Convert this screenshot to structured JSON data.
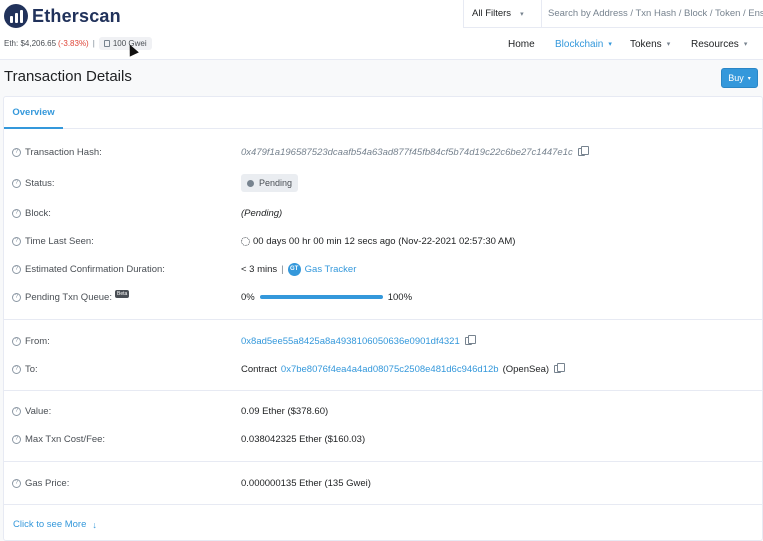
{
  "brand": {
    "name": "Etherscan"
  },
  "search": {
    "filter_label": "All Filters",
    "placeholder": "Search by Address / Txn Hash / Block / Token / Ens"
  },
  "ticker": {
    "eth_price": "Eth: $4,206.65",
    "change": "(-3.83%)",
    "separator": "|",
    "gas": "100 Gwei"
  },
  "nav": {
    "home": "Home",
    "blockchain": "Blockchain",
    "tokens": "Tokens",
    "resources": "Resources"
  },
  "page": {
    "title": "Transaction Details",
    "buy_label": "Buy"
  },
  "tabs": {
    "overview": "Overview"
  },
  "details": {
    "hash": {
      "label": "Transaction Hash:",
      "value": "0x479f1a196587523dcaafb54a63ad877f45fb84cf5b74d19c22c6be27c1447e1c"
    },
    "status": {
      "label": "Status:",
      "value": "Pending"
    },
    "block": {
      "label": "Block:",
      "value": "(Pending)"
    },
    "time": {
      "label": "Time Last Seen:",
      "value": "00 days 00 hr 00 min 12 secs ago (Nov-22-2021 02:57:30 AM)"
    },
    "confirm": {
      "label": "Estimated Confirmation Duration:",
      "value": "< 3 mins",
      "separator": "|",
      "tracker": "Gas Tracker"
    },
    "queue": {
      "label": "Pending Txn Queue:",
      "badge": "Beta",
      "start": "0%",
      "end": "100%",
      "progress": 1.0
    },
    "from": {
      "label": "From:",
      "value": "0x8ad5ee55a8425a8a4938106050636e0901df4321"
    },
    "to": {
      "label": "To:",
      "prefix": "Contract",
      "value": "0x7be8076f4ea4a4ad08075c2508e481d6c946d12b",
      "suffix": "(OpenSea)"
    },
    "value": {
      "label": "Value:",
      "value": "0.09 Ether ($378.60)"
    },
    "fee": {
      "label": "Max Txn Cost/Fee:",
      "value": "0.038042325 Ether ($160.03)"
    },
    "gas_price": {
      "label": "Gas Price:",
      "value": "0.000000135 Ether (135 Gwei)"
    }
  },
  "footer": {
    "see_more": "Click to see More",
    "see_more_arrow": "↓"
  },
  "icons": {
    "help": "?",
    "gas_tracker": "GT",
    "caret": "▾"
  }
}
